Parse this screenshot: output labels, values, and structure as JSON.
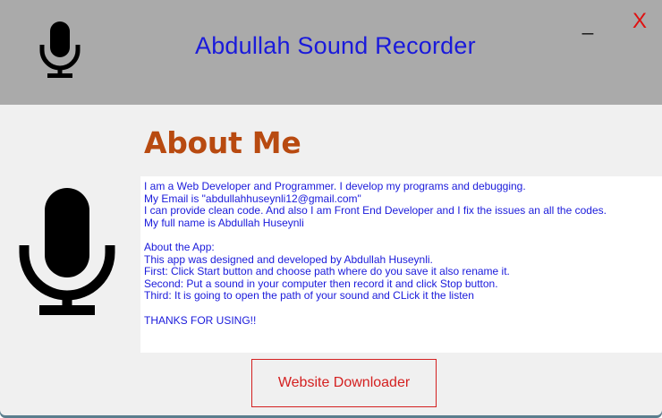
{
  "window": {
    "title": "Abdullah Sound Recorder",
    "minimize_label": "_",
    "close_label": "X"
  },
  "icons": {
    "title_icon": "microphone-icon",
    "side_icon": "microphone-icon"
  },
  "about": {
    "heading": "About Me",
    "lines": [
      "I am a Web Developer and Programmer. I develop my programs and debugging.",
      "My Email is \"abdullahhuseynli12@gmail.com\"",
      "I can provide clean code. And also I am Front End Developer and I fix the issues an all the codes.",
      "My full name is Abdullah Huseynli",
      "",
      "About the App:",
      "This app was designed and developed by Abdullah Huseynli.",
      "First: Click Start button and choose path where do you save it also rename it.",
      "Second: Put a sound in your computer then record it and click Stop button.",
      "Third: It is going to open the path of your sound and CLick it the listen",
      "",
      "THANKS FOR USING!!"
    ]
  },
  "buttons": {
    "website_downloader": "Website Downloader"
  },
  "colors": {
    "titlebar_bg": "#aaaaaa",
    "title_text": "#1a1adb",
    "heading": "#b84a10",
    "close": "#e01010",
    "button_accent": "#d42020"
  }
}
